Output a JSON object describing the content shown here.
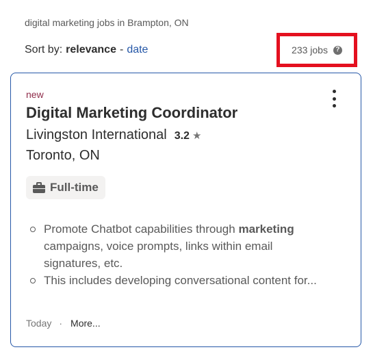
{
  "search": {
    "summary": "digital marketing jobs in Brampton, ON"
  },
  "sort": {
    "label": "Sort by:",
    "current": "relevance",
    "separator": "-",
    "alternate": "date"
  },
  "results": {
    "count_text": "233 jobs",
    "help_icon": "?",
    "highlight_color": "#e4101f"
  },
  "job": {
    "new_label": "new",
    "title": "Digital Marketing Coordinator",
    "company": "Livingston International",
    "rating": "3.2",
    "rating_icon": "★",
    "location": "Toronto, ON",
    "job_type": "Full-time",
    "snippet": [
      {
        "before": "Promote Chatbot capabilities through ",
        "bold": "marketing",
        "after": " campaigns, voice prompts, links within email signatures, etc."
      },
      {
        "before": "This includes developing conversational content for...",
        "bold": "",
        "after": ""
      }
    ],
    "posted": "Today",
    "footer_separator": "·",
    "more_label": "More..."
  },
  "colors": {
    "card_border": "#2557a7",
    "link": "#2557a7",
    "new_tag": "#8f2c4a"
  }
}
